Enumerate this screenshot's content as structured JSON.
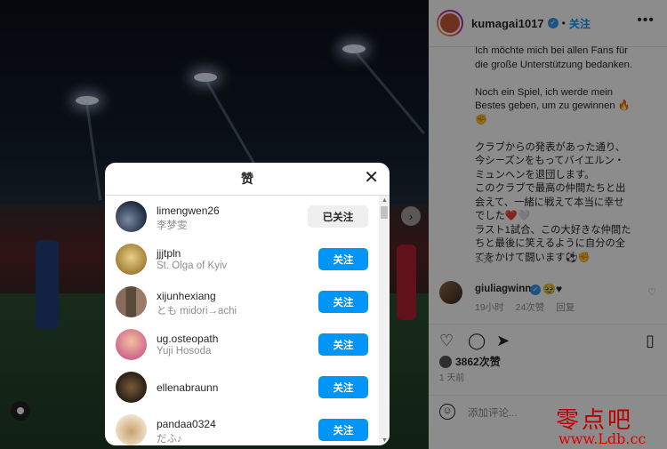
{
  "post": {
    "author": "kumagai1017",
    "follow_label": "关注",
    "caption": "Ich möchte mich bei allen Fans für\ndie große Unterstützung bedanken.\n\nNoch ein Spiel, ich werde mein\nBestes geben, um zu gewinnen 🔥\n✊\n\nクラブからの発表があった通り、\n今シーズンをもってバイエルン・\nミュンヘンを退団します。\nこのクラブで最高の仲間たちと出\n会えて、一緒に戦えて本当に幸せ\nでした❤️🤍\nラスト1試合、この大好きな仲間た\nちと最後に笑えるように自分の全\nてをかけて闘います⚽✊",
    "caption_time": "1 天",
    "comment": {
      "user": "giuliagwinn",
      "text": "🥹♥",
      "time": "19小时",
      "likes": "24次赞",
      "reply": "回复"
    },
    "likes_count": "3862次赞",
    "post_time": "1 天前",
    "comment_placeholder": "添加评论..."
  },
  "modal": {
    "title": "赞",
    "users": [
      {
        "username": "limengwen26",
        "fullname": "李梦雯",
        "button": "已关注",
        "following": true,
        "avatar_color": "#2b3a55"
      },
      {
        "username": "jjjtpln",
        "fullname": "St. Olga of Kyiv",
        "button": "关注",
        "following": false,
        "avatar_color": "#c9a64a"
      },
      {
        "username": "xijunhexiang",
        "fullname": "とも midori→achi",
        "button": "关注",
        "following": false,
        "avatar_color": "#6a4a3a"
      },
      {
        "username": "ug.osteopath",
        "fullname": "Yuji Hosoda",
        "button": "关注",
        "following": false,
        "avatar_color": "#d46a8a"
      },
      {
        "username": "ellenabraunn",
        "fullname": "",
        "button": "关注",
        "following": false,
        "avatar_color": "#4a3a2a"
      },
      {
        "username": "pandaa0324",
        "fullname": "だふ♪",
        "button": "关注",
        "following": false,
        "avatar_color": "#e0c9a8"
      }
    ]
  },
  "watermark": {
    "line1": "零点吧",
    "line2": "www.Ldb.cc"
  }
}
